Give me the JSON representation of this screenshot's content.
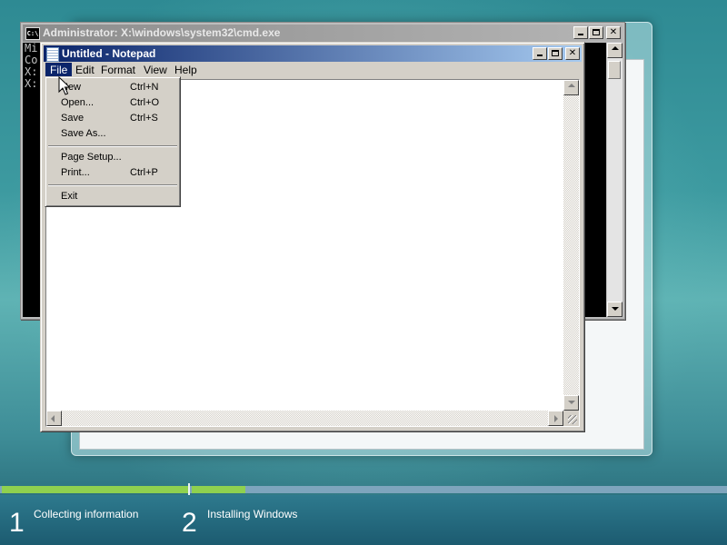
{
  "cmd": {
    "title": "Administrator: X:\\windows\\system32\\cmd.exe",
    "icon_text": "C:\\",
    "lines": [
      "Mi",
      "Co",
      "",
      "X:",
      "",
      "X:"
    ]
  },
  "notepad": {
    "title": "Untitled - Notepad",
    "menu": [
      "File",
      "Edit",
      "Format",
      "View",
      "Help"
    ],
    "active_menu": "File",
    "file_menu": [
      {
        "label": "New",
        "shortcut": "Ctrl+N"
      },
      {
        "label": "Open...",
        "shortcut": "Ctrl+O"
      },
      {
        "label": "Save",
        "shortcut": "Ctrl+S"
      },
      {
        "label": "Save As...",
        "shortcut": ""
      },
      {
        "label": "Page Setup...",
        "shortcut": ""
      },
      {
        "label": "Print...",
        "shortcut": "Ctrl+P"
      },
      {
        "label": "Exit",
        "shortcut": ""
      }
    ]
  },
  "window_buttons": {
    "minimize": "_",
    "maximize": "□",
    "close": "✕"
  },
  "progress": {
    "steps": [
      {
        "number": "1",
        "label": "Collecting information",
        "progress": 1.0
      },
      {
        "number": "2",
        "label": "Installing Windows",
        "progress": 0.1
      }
    ],
    "complete_color": "#8fd14f",
    "track_color": "#7ea5bd"
  }
}
